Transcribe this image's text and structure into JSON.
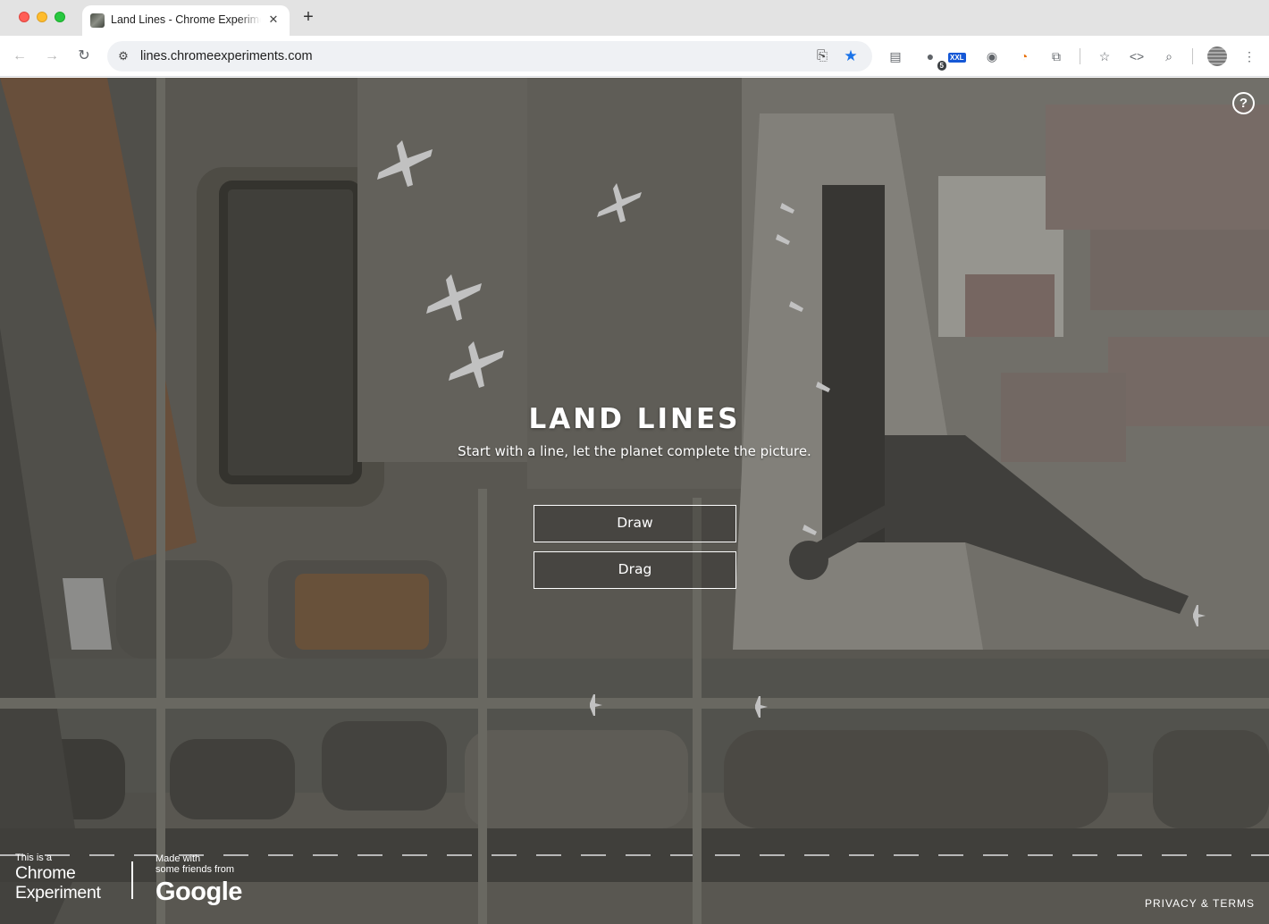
{
  "browser": {
    "tab": {
      "title": "Land Lines - Chrome Experiments",
      "close_label": "✕"
    },
    "new_tab_label": "+",
    "nav": {
      "back": "←",
      "forward": "→",
      "reload": "↻"
    },
    "address": {
      "url": "lines.chromeexperiments.com",
      "site_info_icon": "⚙"
    },
    "omnibox_icons": {
      "install": "⎘",
      "star": "★"
    },
    "extensions": [
      {
        "name": "docs-icon",
        "glyph": "▤"
      },
      {
        "name": "extension-badge-icon",
        "glyph": "●",
        "badge": "5"
      },
      {
        "name": "xxl-extension-icon",
        "glyph": "",
        "badge": "XXL"
      },
      {
        "name": "circle-dots-icon",
        "glyph": "◉"
      },
      {
        "name": "clock-color-icon",
        "glyph": "◔"
      },
      {
        "name": "puzzle-icon",
        "glyph": "⧉"
      },
      {
        "name": "bookmark-star-icon",
        "glyph": "☆"
      },
      {
        "name": "code-icon",
        "glyph": "<>"
      },
      {
        "name": "search-tab-icon",
        "glyph": "⌕"
      },
      {
        "name": "menu-icon",
        "glyph": "⋮"
      }
    ]
  },
  "page": {
    "help_label": "?",
    "title": "LAND LINES",
    "subtitle": "Start with a line, let the planet complete the picture.",
    "buttons": {
      "draw": "Draw",
      "drag": "Drag"
    },
    "footer": {
      "chrome_small": "This is a",
      "chrome_line1": "Chrome",
      "chrome_line2": "Experiment",
      "made_with_1": "Made with",
      "made_with_2": "some friends from",
      "google": "Google",
      "privacy": "PRIVACY & TERMS"
    }
  }
}
